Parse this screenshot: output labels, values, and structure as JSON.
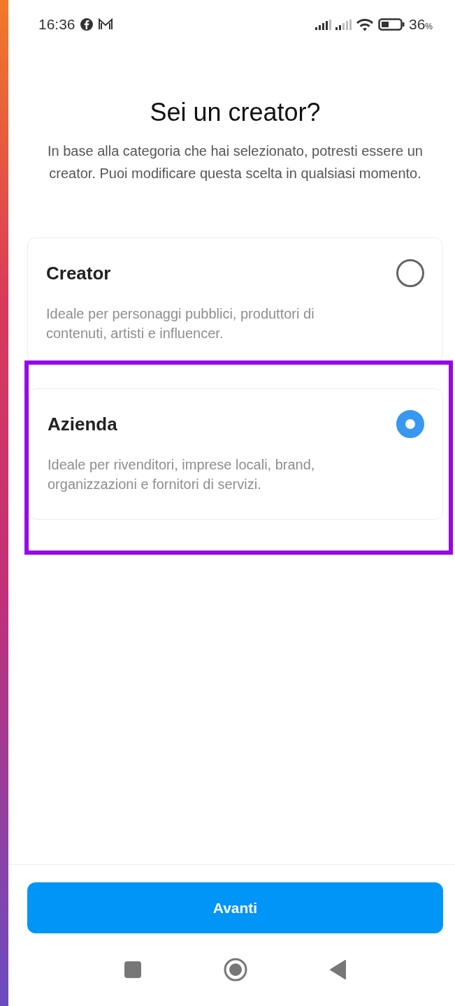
{
  "status_bar": {
    "time": "16:36",
    "battery_value": "36",
    "battery_unit": "%"
  },
  "title": "Sei un creator?",
  "subtitle": "In base alla categoria che hai selezionato, potresti essere un creator. Puoi modificare questa scelta in qualsiasi momento.",
  "options": [
    {
      "title": "Creator",
      "description": "Ideale per personaggi pubblici, produttori di contenuti, artisti e influencer.",
      "selected": false,
      "highlighted": false
    },
    {
      "title": "Azienda",
      "description": "Ideale per rivenditori, imprese locali, brand, organizzazioni e fornitori di servizi.",
      "selected": true,
      "highlighted": true
    }
  ],
  "button": "Avanti"
}
